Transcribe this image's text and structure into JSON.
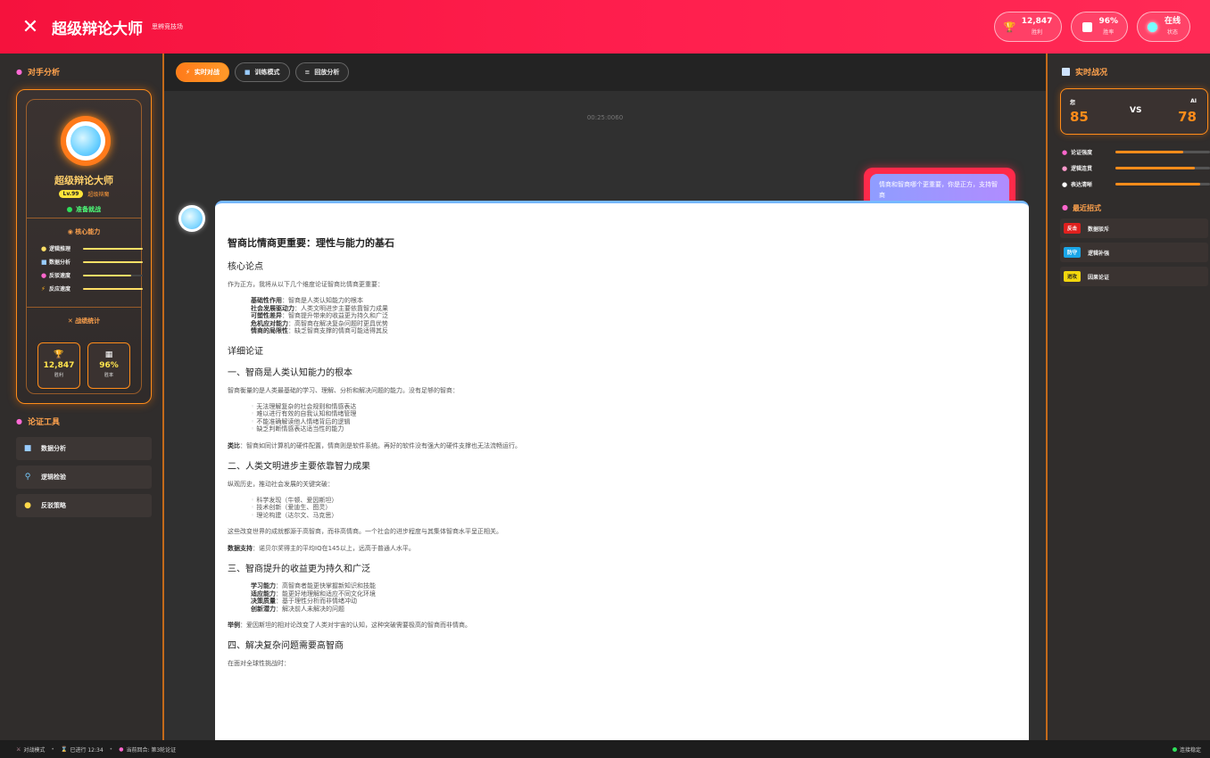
{
  "header": {
    "logo_icon": "crossed-swords-icon",
    "title": "超级辩论大师",
    "subtitle": "思辨竞技场",
    "stats": [
      {
        "value": "12,847",
        "label": "胜利",
        "icon": "trophy-icon"
      },
      {
        "value": "96%",
        "label": "胜率",
        "icon": "chart-icon"
      },
      {
        "value": "在线",
        "label": "状态",
        "icon": "status-dot-icon"
      }
    ]
  },
  "left": {
    "opponent_title": "对手分析",
    "name": "超级辩论大师",
    "level": "Lv.99",
    "rank": "超级辩魔",
    "status": "准备就战",
    "core_title": "核心能力",
    "skills": [
      {
        "label": "逻辑推理",
        "value": 1.0
      },
      {
        "label": "数据分析",
        "value": 1.0
      },
      {
        "label": "反驳速度",
        "value": 0.8
      },
      {
        "label": "反应速度",
        "value": 1.0
      }
    ],
    "stats_title": "战绩统计",
    "mini_stats": [
      {
        "value": "12,847",
        "label": "胜利"
      },
      {
        "value": "96%",
        "label": "胜率"
      }
    ],
    "tools_title": "论证工具",
    "tools": [
      {
        "label": "数据分析",
        "icon": "chart-icon"
      },
      {
        "label": "逻辑检验",
        "icon": "search-icon"
      },
      {
        "label": "反驳策略",
        "icon": "lightbulb-icon"
      }
    ]
  },
  "tabs": [
    {
      "label": "实时对战",
      "active": true
    },
    {
      "label": "训练模式",
      "active": false
    },
    {
      "label": "回放分析",
      "active": false
    }
  ],
  "chat": {
    "timestamp": "00:25:0060",
    "user_message": "情商和智商哪个更重要，你是正方，支持智商",
    "doc": {
      "title": "智商比情商更重要：理性与能力的基石",
      "core_heading": "核心论点",
      "intro": "作为正方，我将从以下几个维度论证智商比情商更重要：",
      "core_points": [
        {
          "k": "基础性作用",
          "v": "：智商是人类认知能力的根本"
        },
        {
          "k": "社会发展驱动力",
          "v": "：人类文明进步主要依靠智力成果"
        },
        {
          "k": "可塑性差异",
          "v": "：智商提升带来的收益更为持久和广泛"
        },
        {
          "k": "危机应对能力",
          "v": "：高智商在解决复杂问题时更具优势"
        },
        {
          "k": "情商的局限性",
          "v": "：缺乏智商支撑的情商可能适得其反"
        }
      ],
      "detail_heading": "详细论证",
      "s1_heading": "一、智商是人类认知能力的根本",
      "s1_text": "智商衡量的是人类最基础的学习、理解、分析和解决问题的能力。没有足够的智商：",
      "s1_list": [
        "无法理解复杂的社会规则和情感表达",
        "难以进行有效的自我认知和情绪管理",
        "不能准确解读他人情绪背后的逻辑",
        "缺乏判断情感表达适当性的能力"
      ],
      "s1_analogy_k": "类比",
      "s1_analogy": "：智商如同计算机的硬件配置，情商则是软件系统。再好的软件没有强大的硬件支撑也无法流畅运行。",
      "s2_heading": "二、人类文明进步主要依靠智力成果",
      "s2_text": "纵观历史，推动社会发展的关键突破：",
      "s2_list": [
        "科学发现（牛顿、爱因斯坦）",
        "技术创新（爱迪生、图灵）",
        "理论构建（达尔文、马克思）"
      ],
      "s2_text2": "这些改变世界的成就都源于高智商，而非高情商。一个社会的进步程度与其集体智商水平呈正相关。",
      "s2_data_k": "数据支持",
      "s2_data": "：诺贝尔奖得主的平均IQ在145以上，远高于普通人水平。",
      "s3_heading": "三、智商提升的收益更为持久和广泛",
      "s3_points": [
        {
          "k": "学习能力",
          "v": "：高智商者能更快掌握新知识和技能"
        },
        {
          "k": "适应能力",
          "v": "：能更好地理解和适应不同文化环境"
        },
        {
          "k": "决策质量",
          "v": "：基于理性分析而非情绪冲动"
        },
        {
          "k": "创新潜力",
          "v": "：解决前人未解决的问题"
        }
      ],
      "s3_example_k": "举例",
      "s3_example": "：爱因斯坦的相对论改变了人类对宇宙的认知，这种突破需要极高的智商而非情商。",
      "s4_heading": "四、解决复杂问题需要高智商",
      "s4_text": "在面对全球性挑战时："
    }
  },
  "right": {
    "title": "实时战况",
    "you_label": "您",
    "you_score": "85",
    "vs": "VS",
    "ai_label": "AI",
    "ai_score": "78",
    "metrics": [
      {
        "label": "论证强度",
        "value": 0.72
      },
      {
        "label": "逻辑连贯",
        "value": 0.84
      },
      {
        "label": "表达清晰",
        "value": 0.9
      }
    ],
    "recent_title": "最近招式",
    "recent": [
      {
        "tag": "反击",
        "label": "数据驳斥",
        "color": "#e0201e"
      },
      {
        "tag": "防守",
        "label": "逻辑补强",
        "color": "#1aa6e8"
      },
      {
        "tag": "进攻",
        "label": "因果论证",
        "color": "#f2d60d"
      }
    ]
  },
  "footer": {
    "mode": "对战模式",
    "elapsed": "已进行 12:34",
    "round": "当前回合: 第3轮论证",
    "connection": "连接稳定"
  },
  "colors": {
    "header": "#ff1f4e",
    "accent": "#ff8c1a",
    "panel": "#302d2c"
  }
}
